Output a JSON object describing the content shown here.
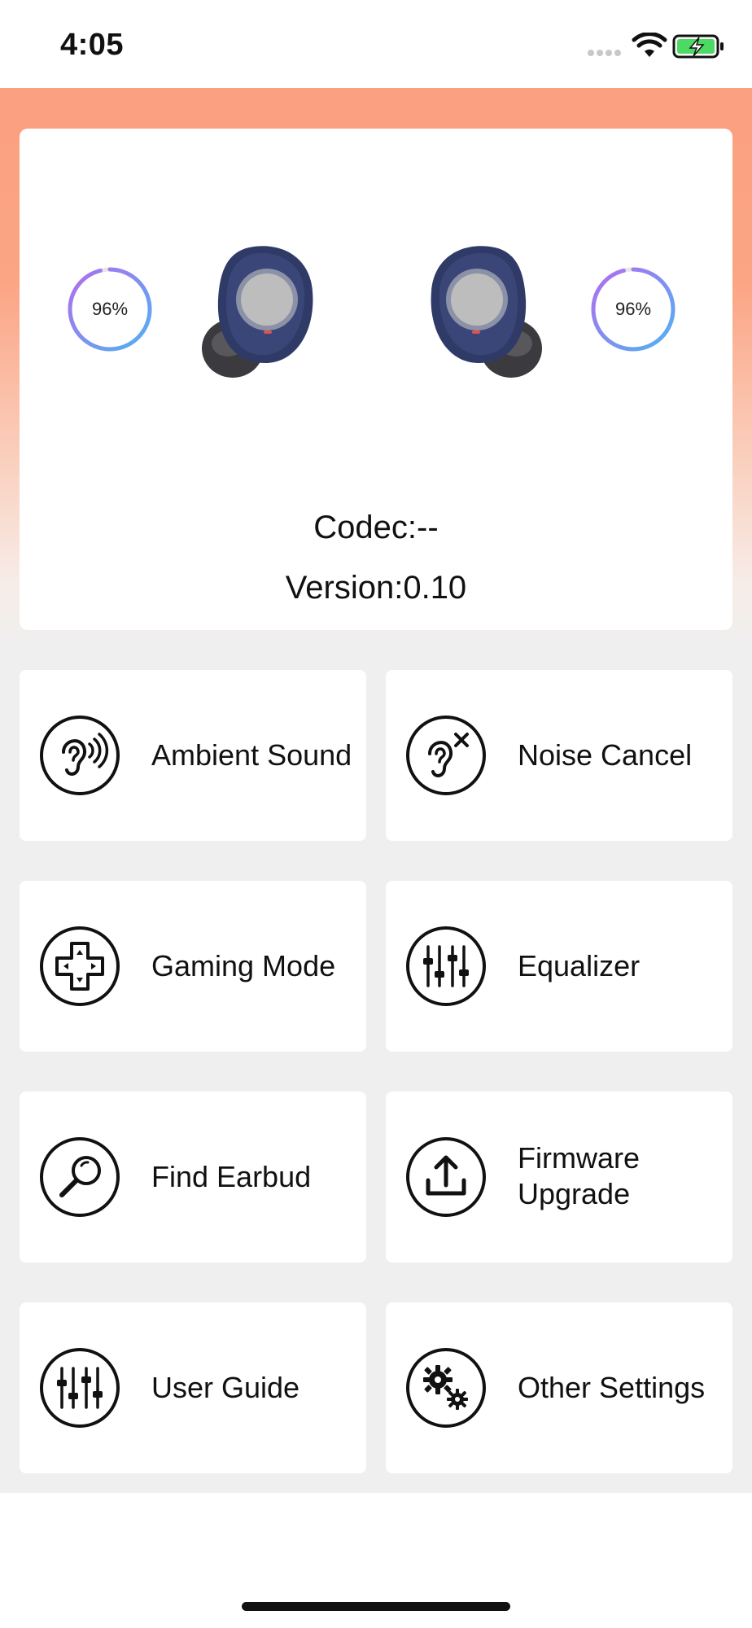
{
  "status_bar": {
    "time": "4:05",
    "icons": [
      "cellular-dots-icon",
      "wifi-icon",
      "battery-charging-icon"
    ],
    "battery_color": "#4cd964"
  },
  "device": {
    "left_battery": "96%",
    "right_battery": "96%",
    "left_battery_level": 0.96,
    "right_battery_level": 0.96,
    "codec_text": "Codec:--",
    "version_text": "Version:0.10"
  },
  "colors": {
    "header_gradient_top": "#fba081",
    "ring_gradient_start": "#4fb3f2",
    "ring_gradient_end": "#b36cf0",
    "earbud_body": "#2f3a66",
    "background": "#efefef"
  },
  "menu": {
    "items": [
      {
        "label": "Ambient Sound",
        "icon": "ear-sound-waves-icon"
      },
      {
        "label": "Noise Cancel",
        "icon": "ear-mute-icon"
      },
      {
        "label": "Gaming Mode",
        "icon": "gamepad-icon"
      },
      {
        "label": "Equalizer",
        "icon": "equalizer-sliders-icon"
      },
      {
        "label": "Find Earbud",
        "icon": "magnifier-icon"
      },
      {
        "label": "Firmware Upgrade",
        "icon": "upload-icon"
      },
      {
        "label": "User Guide",
        "icon": "sliders-icon"
      },
      {
        "label": "Other Settings",
        "icon": "gears-icon"
      }
    ]
  }
}
